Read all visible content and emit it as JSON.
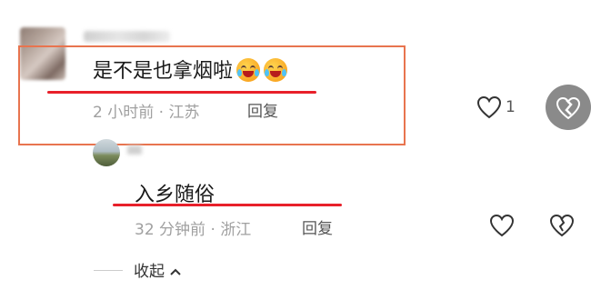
{
  "comment": {
    "text": "是不是也拿烟啦",
    "emoji": [
      "crying-laughing-emoji",
      "crying-laughing-emoji"
    ],
    "time": "2 小时前",
    "separator": "·",
    "location": "江苏",
    "reply_label": "回复",
    "like_count": "1"
  },
  "reply": {
    "text": "入乡随俗",
    "time": "32 分钟前",
    "separator": "·",
    "location": "浙江",
    "reply_label": "回复"
  },
  "collapse_label": "收起",
  "colors": {
    "highlight_box": "#e8744f",
    "underline": "#e8202a",
    "meta_text": "#a0a0a0"
  }
}
